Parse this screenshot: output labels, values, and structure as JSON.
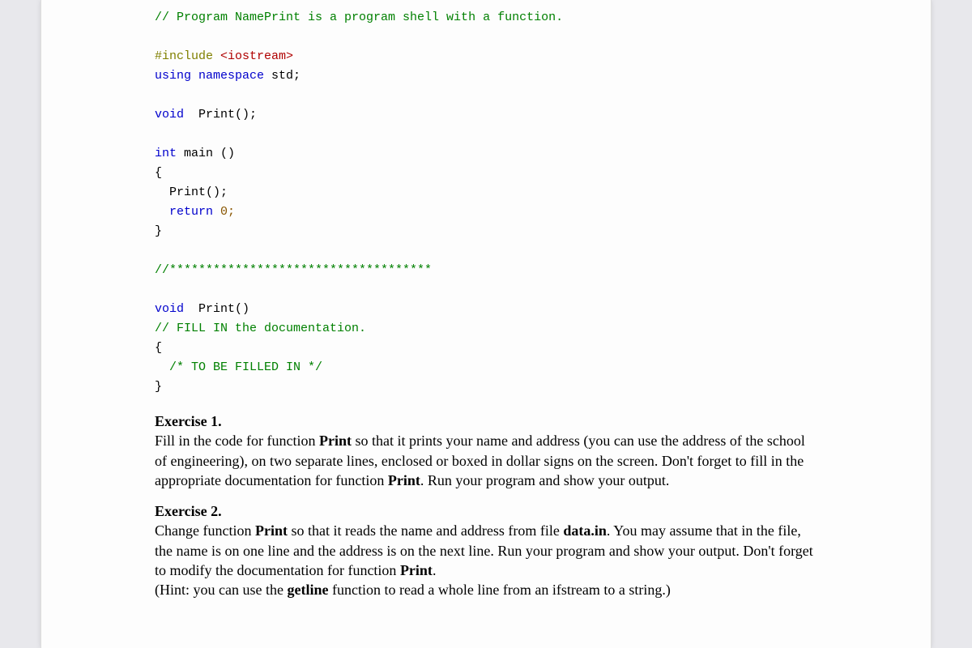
{
  "code": {
    "l1": "// Program NamePrint is a program shell with a function.",
    "l2a": "#include ",
    "l2b": "<iostream>",
    "l3a": "using ",
    "l3b": "namespace ",
    "l3c": "std;",
    "l4a": "void",
    "l4b": "  Print();",
    "l5a": "int ",
    "l5b": "main ()",
    "l6": "{",
    "l7": "  Print();",
    "l8a": "  ",
    "l8b": "return",
    "l8c": " 0;",
    "l9": "}",
    "l10": "//************************************",
    "l11a": "void",
    "l11b": "  Print()",
    "l12": "// FILL IN the documentation.",
    "l13": "{",
    "l14a": "  ",
    "l14b": "/* TO BE FILLED IN */",
    "l15": "}"
  },
  "ex1": {
    "title": "Exercise 1.",
    "p1a": "Fill in the code for function ",
    "p1b": "Print",
    "p1c": " so that it prints your name and address (you can use the address of the school of engineering), on two separate lines, enclosed or boxed in dollar signs on the screen. Don't forget to fill in the appropriate documentation for function ",
    "p1d": "Print",
    "p1e": ". Run your program and show your output."
  },
  "ex2": {
    "title": "Exercise 2.",
    "p1a": "Change function ",
    "p1b": "Print",
    "p1c": " so that it reads the name and address from file ",
    "p1d": "data.in",
    "p1e": ". You may assume that in the file, the name is on one line and the address is on the next line. Run your program and show your output. Don't forget to modify the documentation for function ",
    "p1f": "Print",
    "p1g": ".",
    "hintA": "(Hint: you can use the ",
    "hintB": "getline",
    "hintC": " function to read a whole line from an ifstream to a string.)"
  }
}
